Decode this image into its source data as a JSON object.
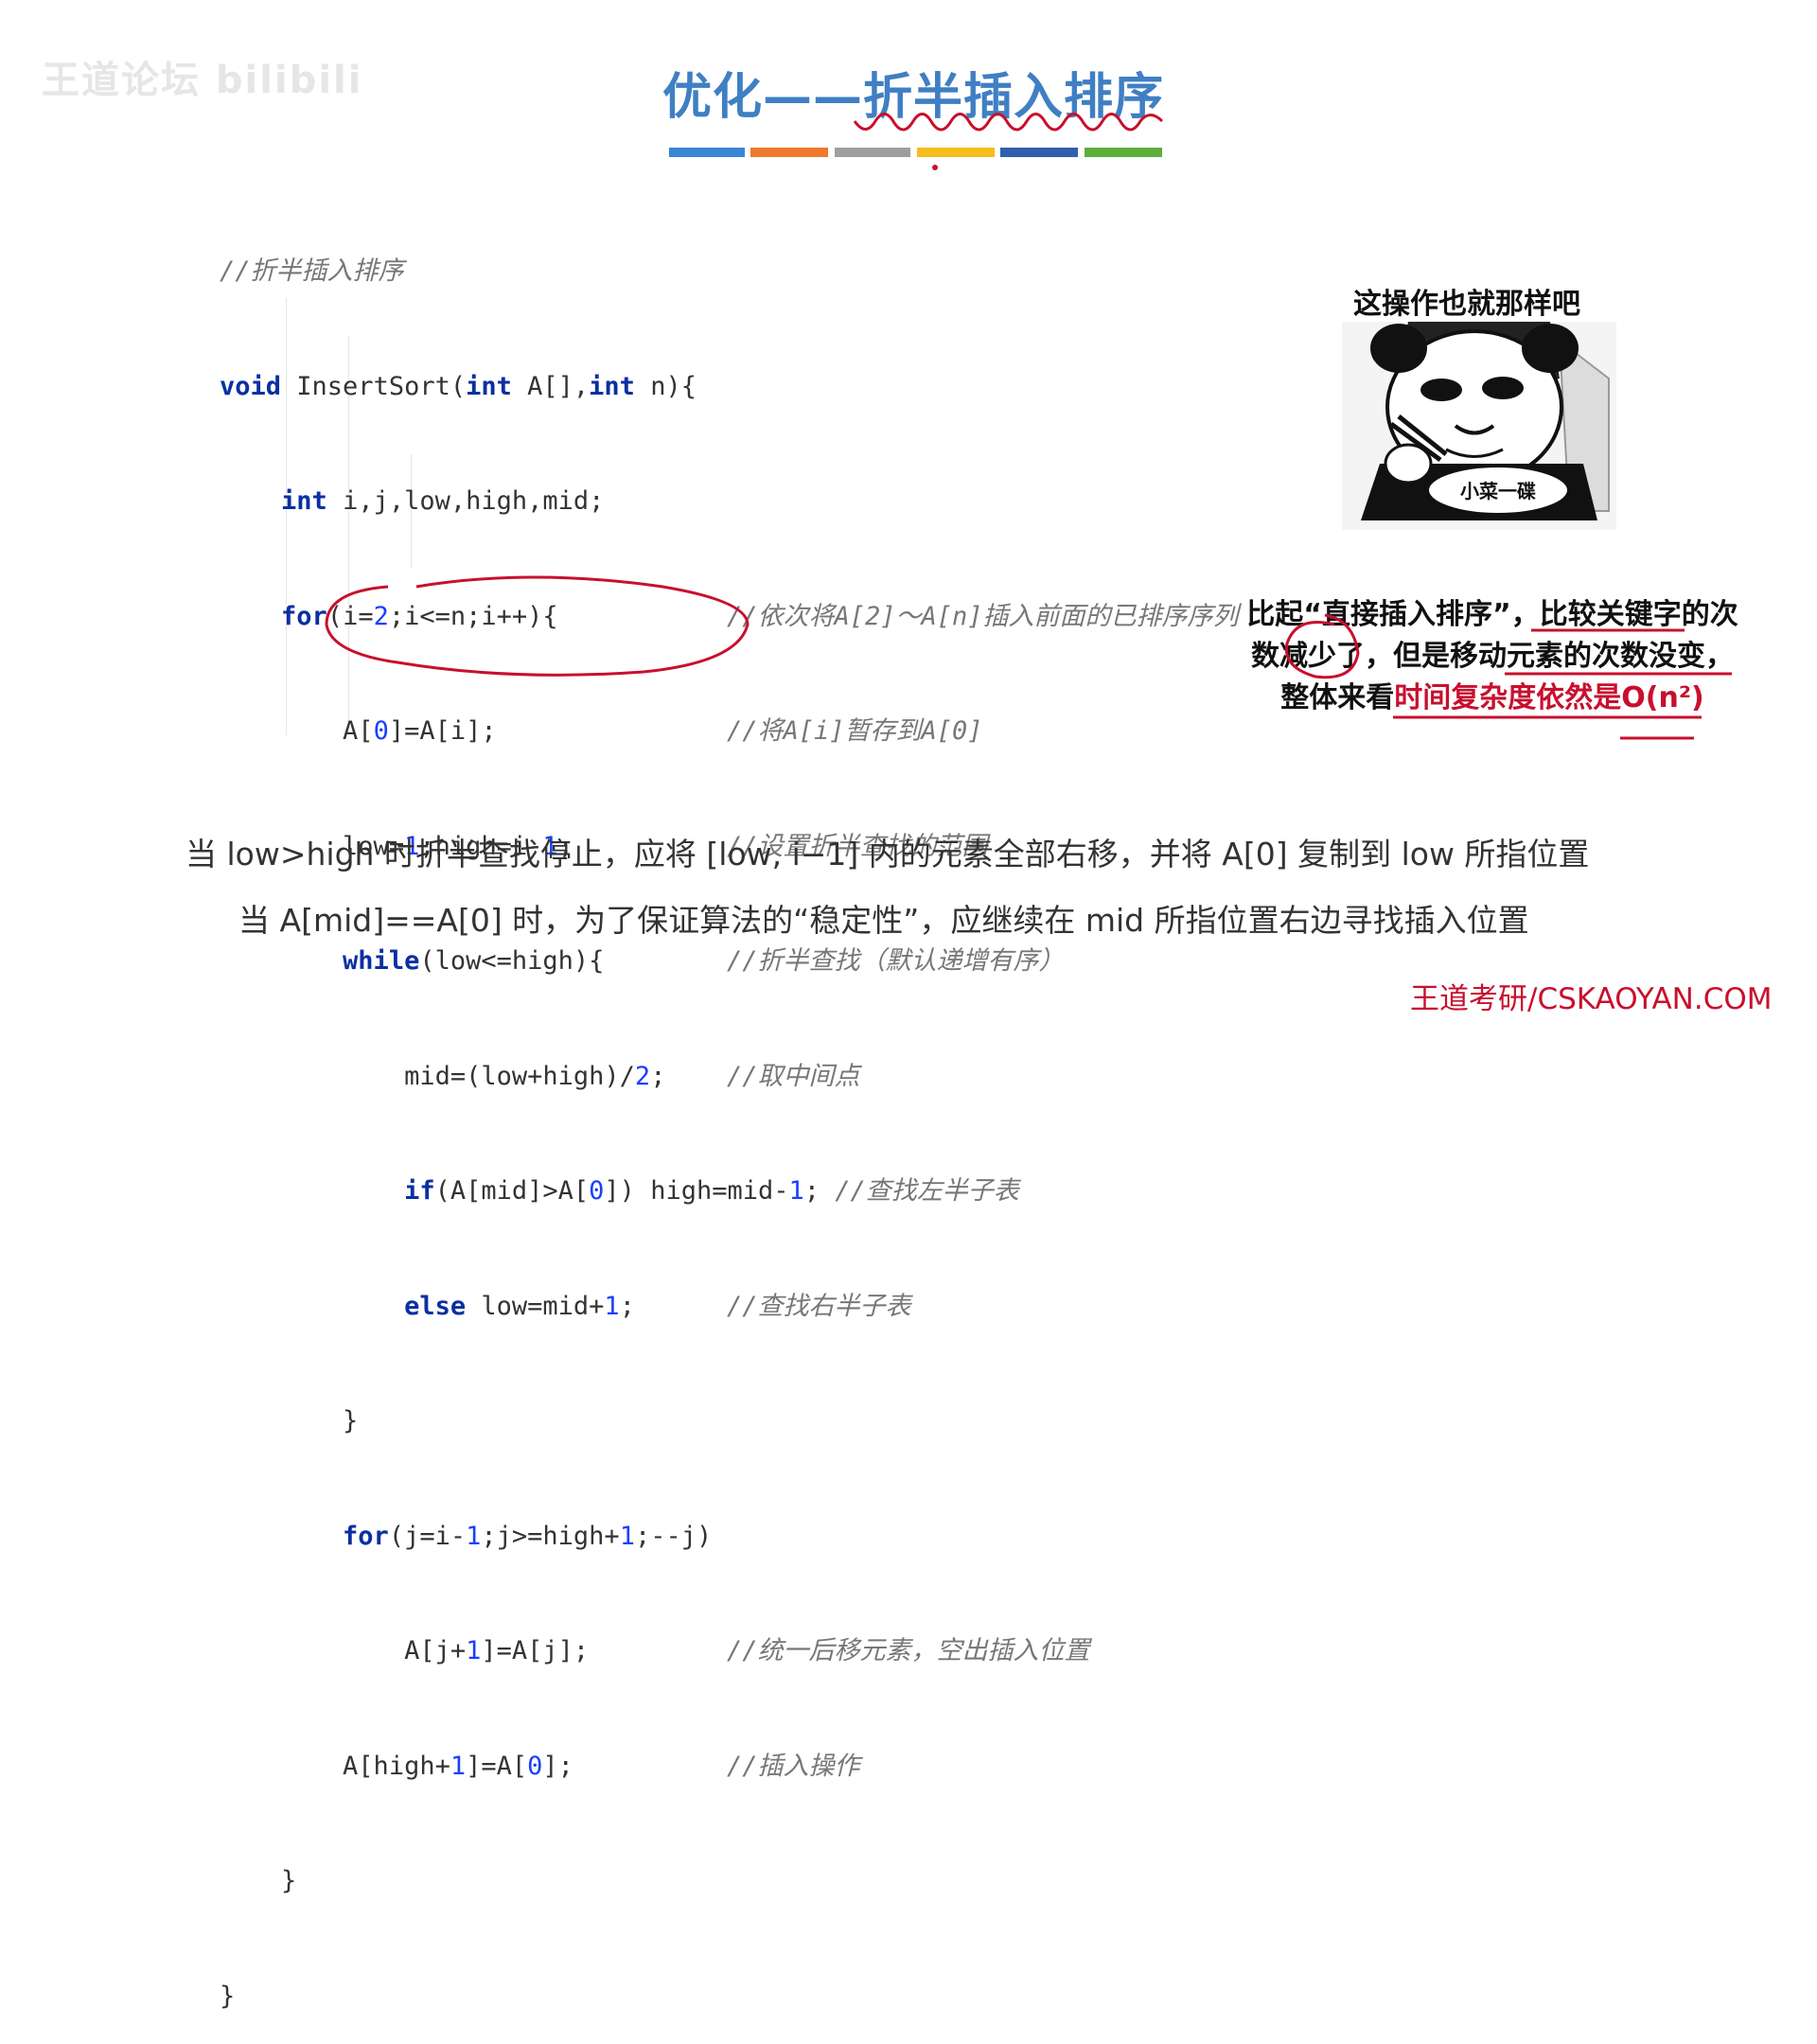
{
  "watermark": "王道论坛 bilibili",
  "title": "优化——折半插入排序",
  "colorbar": [
    "#3a85d6",
    "#f07a2a",
    "#9e9e9e",
    "#f5bd1d",
    "#2f5fae",
    "#5eae3c"
  ],
  "code": {
    "l1": "//折半插入排序",
    "l2_void": "void",
    "l2_a": " InsertSort(",
    "l2_int1": "int",
    "l2_b": " A[],",
    "l2_int2": "int",
    "l2_c": " n){",
    "l3_int": "int",
    "l3_rest": " i,j,low,high,mid;",
    "l4_for": "for",
    "l4_a": "(i=",
    "l4_n": "2",
    "l4_b": ";i<=n;i++){",
    "l4_cm": "//依次将A[2]～A[n]插入前面的已排序序列",
    "l5_a": "A[",
    "l5_n": "0",
    "l5_b": "]=A[i];",
    "l5_cm": "//将A[i]暂存到A[0]",
    "l6_a": "low=",
    "l6_n1": "1",
    "l6_b": ";high=i-",
    "l6_n2": "1",
    "l6_c": ";",
    "l6_cm": "//设置折半查找的范围",
    "l7_while": "while",
    "l7_a": "(low<=high){",
    "l7_cm": "//折半查找（默认递增有序）",
    "l8_a": "mid=(low+high)/",
    "l8_n": "2",
    "l8_b": ";",
    "l8_cm": "//取中间点",
    "l9_if": "if",
    "l9_a": "(A[mid]>A[",
    "l9_n1": "0",
    "l9_b": "]) high=mid-",
    "l9_n2": "1",
    "l9_c": ";",
    "l9_cm": "//查找左半子表",
    "l10_else": "else",
    "l10_a": " low=mid+",
    "l10_n": "1",
    "l10_b": ";",
    "l10_cm": "//查找右半子表",
    "l11": "}",
    "l12_for": "for",
    "l12_a": "(j=i-",
    "l12_n1": "1",
    "l12_b": ";j>=high+",
    "l12_n2": "1",
    "l12_c": ";--j)",
    "l13_a": "A[j+",
    "l13_n": "1",
    "l13_b": "]=A[j];",
    "l13_cm": "//统一后移元素，空出插入位置",
    "l14_a": "A[high+",
    "l14_n1": "1",
    "l14_b": "]=A[",
    "l14_n2": "0",
    "l14_c": "];",
    "l14_cm": "//插入操作",
    "l15": "}",
    "l16": "}"
  },
  "meme_caption": "这操作也就那样吧",
  "meme_bowl_text": "小菜一碟",
  "note": {
    "p1": "比起“直接插入排序”，比较关键字的次数减少了，但是移动元素的次数没变，整体来看",
    "p2": "时间复杂度依然是O(n²)"
  },
  "bottom1": "当 low>high 时折半查找停止，应将 [low, i−1] 内的元素全部右移，并将 A[0] 复制到 low 所指位置",
  "bottom2": "当 A[mid]==A[0] 时，为了保证算法的“稳定性”，应继续在 mid 所指位置右边寻找插入位置",
  "footer": "王道考研/CSKAOYAN.COM"
}
